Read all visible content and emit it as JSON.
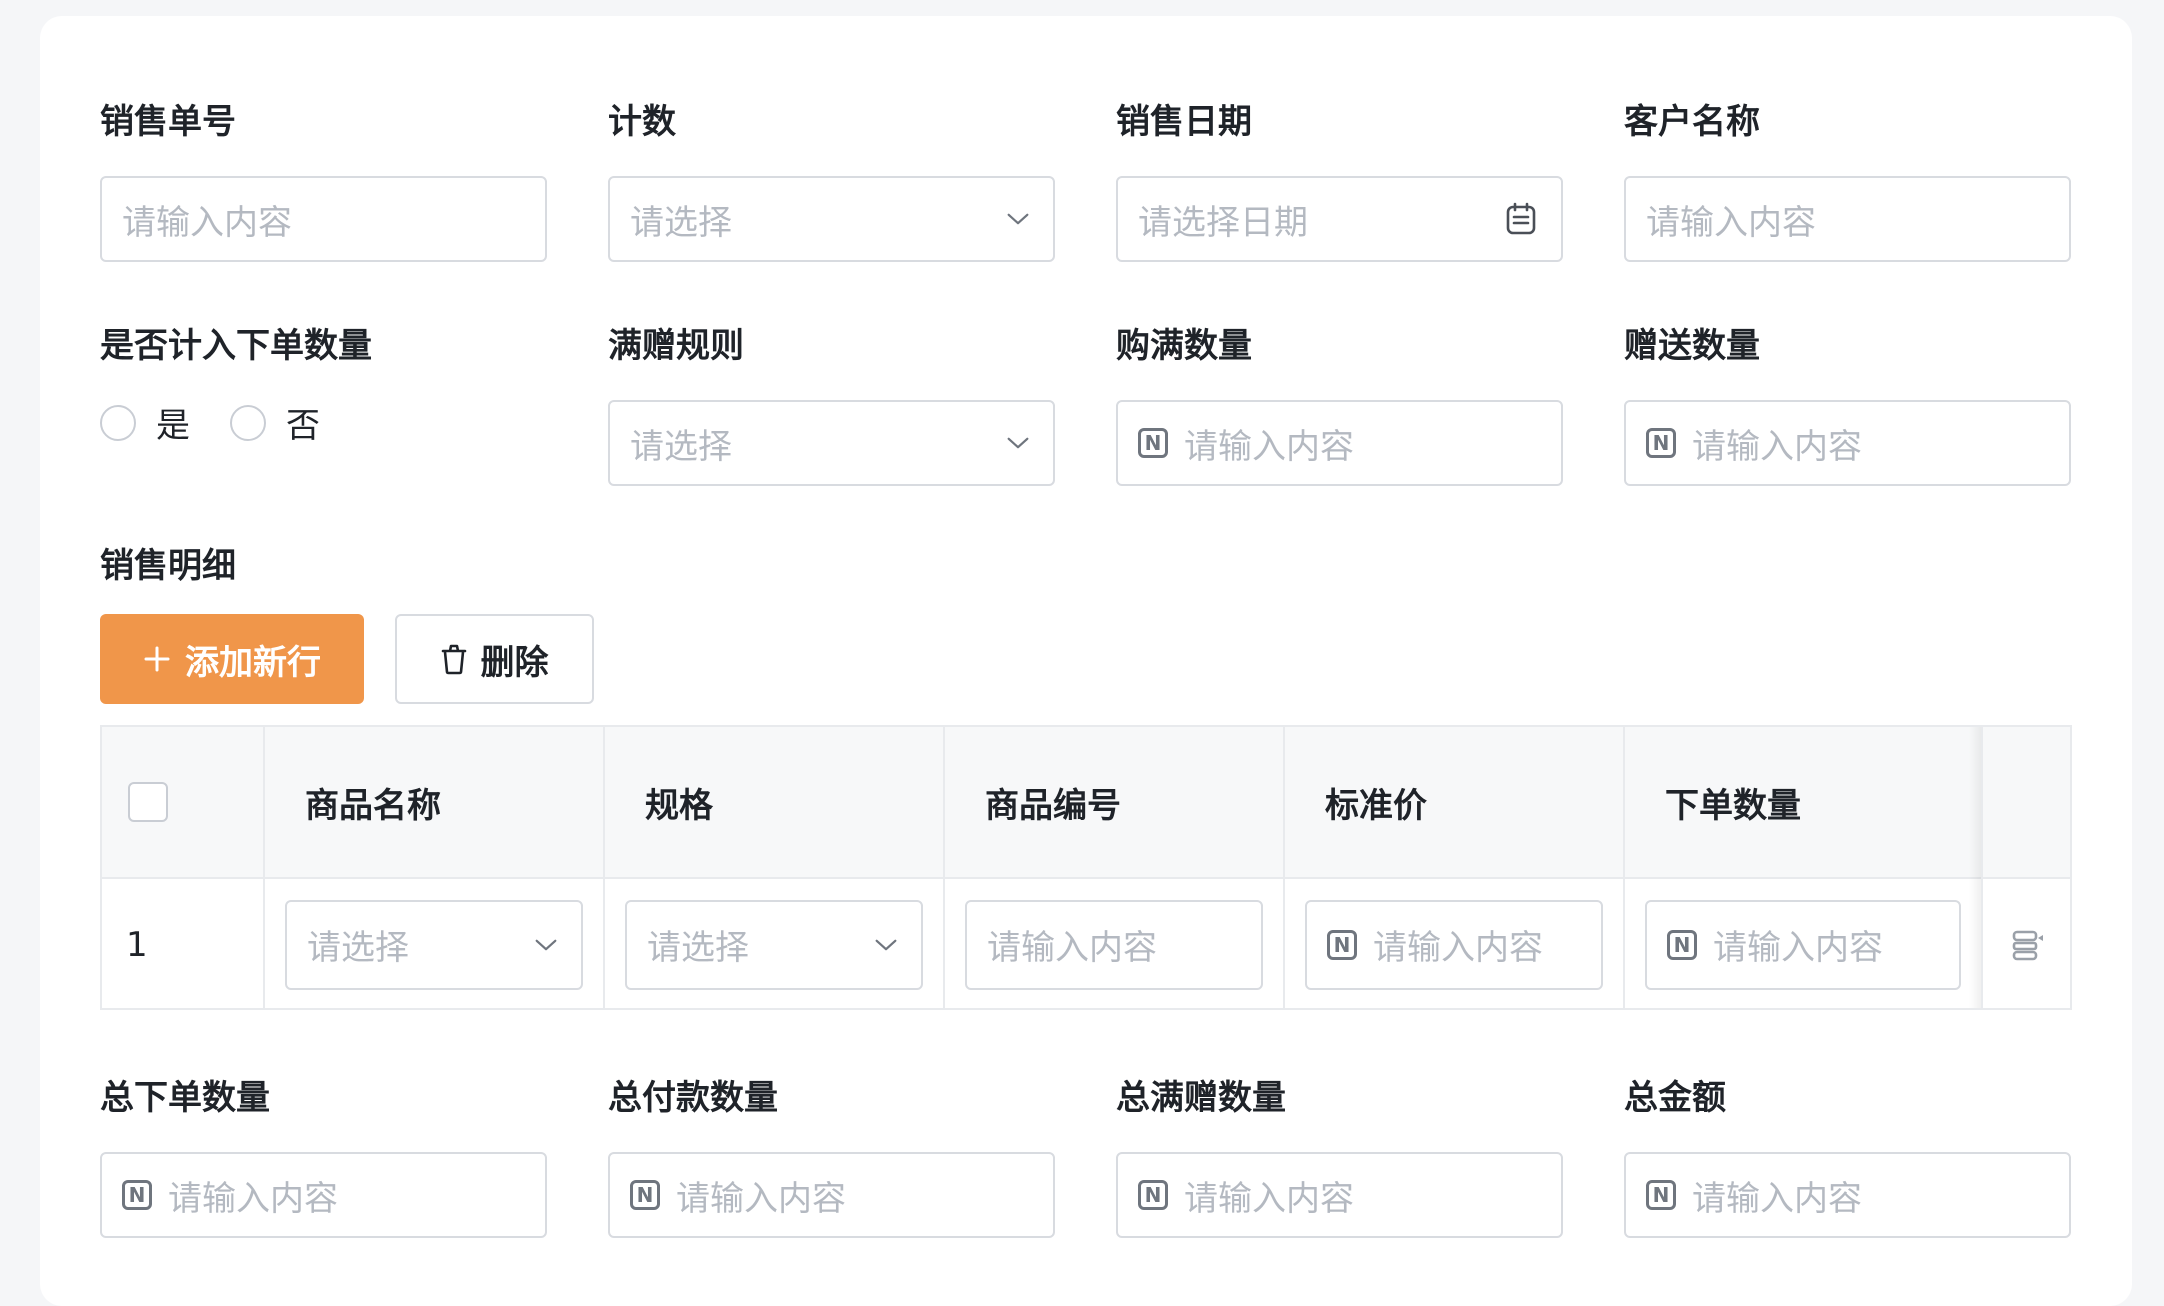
{
  "form": {
    "row1": [
      {
        "label": "销售单号",
        "placeholder": "请输入内容",
        "kind": "text"
      },
      {
        "label": "计数",
        "placeholder": "请选择",
        "kind": "select"
      },
      {
        "label": "销售日期",
        "placeholder": "请选择日期",
        "kind": "date"
      },
      {
        "label": "客户名称",
        "placeholder": "请输入内容",
        "kind": "text"
      }
    ],
    "row2": {
      "include_order_qty": {
        "label": "是否计入下单数量",
        "options": [
          "是",
          "否"
        ]
      },
      "gift_rule": {
        "label": "满赠规则",
        "placeholder": "请选择"
      },
      "purchase_qty": {
        "label": "购满数量",
        "placeholder": "请输入内容"
      },
      "gift_qty": {
        "label": "赠送数量",
        "placeholder": "请输入内容"
      }
    },
    "row3": [
      {
        "label": "总下单数量",
        "placeholder": "请输入内容"
      },
      {
        "label": "总付款数量",
        "placeholder": "请输入内容"
      },
      {
        "label": "总满赠数量",
        "placeholder": "请输入内容"
      },
      {
        "label": "总金额",
        "placeholder": "请输入内容"
      }
    ]
  },
  "detail": {
    "title": "销售明细",
    "add_button": "添加新行",
    "delete_button": "删除",
    "columns": [
      "商品名称",
      "规格",
      "商品编号",
      "标准价",
      "下单数量"
    ],
    "rows": [
      {
        "index": "1",
        "product_name": "请选择",
        "spec": "请选择",
        "product_code": "请输入内容",
        "standard_price": "请输入内容",
        "order_qty": "请输入内容"
      }
    ]
  },
  "icons": {
    "number": "N",
    "calendar": "calendar-icon",
    "chevron": "chevron-down-icon",
    "plus": "plus-icon",
    "trash": "trash-icon",
    "row_action": "row-action-icon"
  },
  "colors": {
    "primary": "#f0964a",
    "border": "#d8dbe0",
    "placeholder": "#b4b9c1",
    "header_bg": "#f7f8f9"
  }
}
